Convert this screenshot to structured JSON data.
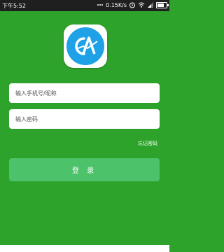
{
  "status_bar": {
    "time": "下午5:52",
    "net_speed": "0.15K/s"
  },
  "app": {
    "logo_icon": "app-logo-icon"
  },
  "login_form": {
    "account_placeholder": "输入手机号/昵称",
    "password_placeholder": "输入密码",
    "forgot_password": "忘记密码",
    "login_label": "登 录"
  },
  "colors": {
    "background": "#2ea32b",
    "button": "#4cc26a",
    "logo_blue": "#1ea1e6"
  }
}
